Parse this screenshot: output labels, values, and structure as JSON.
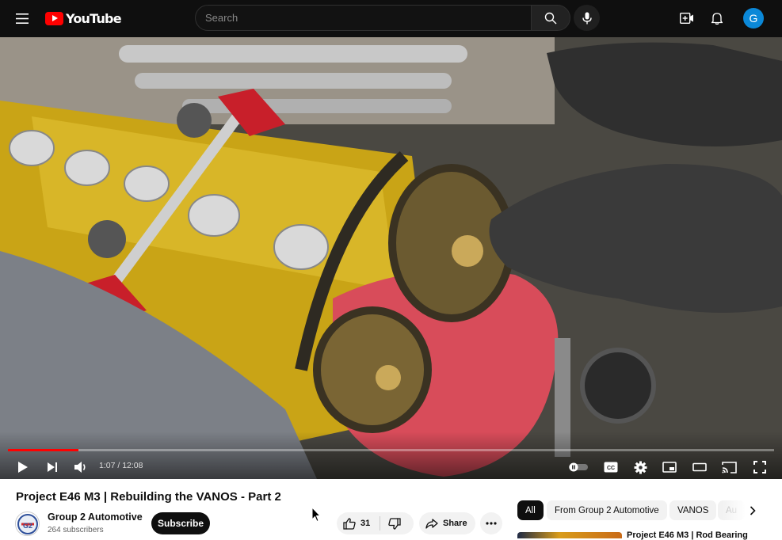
{
  "header": {
    "logo_text": "YouTube",
    "search_placeholder": "Search",
    "avatar_initial": "G",
    "avatar_color": "#0b88d8",
    "brand_color": "#ff0000"
  },
  "player": {
    "current_time": "1:07",
    "duration": "12:08",
    "time_display": "1:07 / 12:08",
    "progress_fraction": 0.092,
    "progress_color": "#ff0000"
  },
  "video": {
    "title": "Project E46 M3 | Rebuilding the VANOS - Part 2",
    "channel_name": "Group 2 Automotive",
    "subscribers": "264 subscribers",
    "subscribe_label": "Subscribe",
    "like_count": "31",
    "share_label": "Share"
  },
  "chips": [
    {
      "label": "All",
      "active": true
    },
    {
      "label": "From Group 2 Automotive",
      "active": false
    },
    {
      "label": "VANOS",
      "active": false
    },
    {
      "label": "Au",
      "active": false
    }
  ],
  "recommendation": {
    "title": "Project E46 M3 | Rod Bearing"
  }
}
